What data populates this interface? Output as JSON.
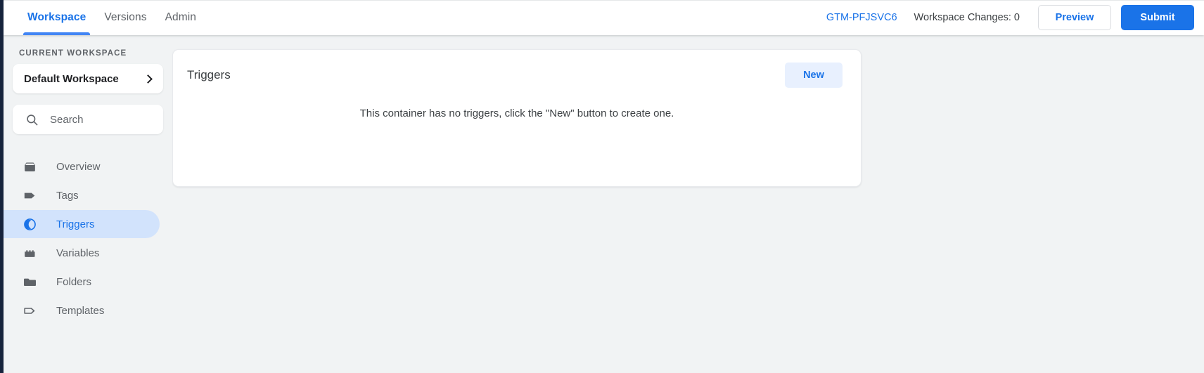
{
  "header": {
    "tabs": [
      {
        "label": "Workspace",
        "active": true
      },
      {
        "label": "Versions",
        "active": false
      },
      {
        "label": "Admin",
        "active": false
      }
    ],
    "container_id": "GTM-PFJSVC6",
    "workspace_changes": "Workspace Changes: 0",
    "preview_label": "Preview",
    "submit_label": "Submit"
  },
  "sidebar": {
    "section_label": "CURRENT WORKSPACE",
    "workspace_name": "Default Workspace",
    "search_placeholder": "Search",
    "search_value": "",
    "items": [
      {
        "label": "Overview",
        "icon": "overview-icon",
        "active": false
      },
      {
        "label": "Tags",
        "icon": "tag-filled-icon",
        "active": false
      },
      {
        "label": "Triggers",
        "icon": "trigger-icon",
        "active": true
      },
      {
        "label": "Variables",
        "icon": "variable-icon",
        "active": false
      },
      {
        "label": "Folders",
        "icon": "folder-icon",
        "active": false
      },
      {
        "label": "Templates",
        "icon": "tag-outline-icon",
        "active": false
      }
    ]
  },
  "main": {
    "card_title": "Triggers",
    "new_label": "New",
    "empty_message": "This container has no triggers, click the \"New\" button to create one."
  },
  "colors": {
    "accent_blue": "#1a73e8",
    "tab_indicator": "#4285f4",
    "active_pill": "#d2e3fc",
    "new_button_bg": "#e8f0fe",
    "page_bg": "#f1f3f4",
    "rail_navy": "#16233c"
  }
}
